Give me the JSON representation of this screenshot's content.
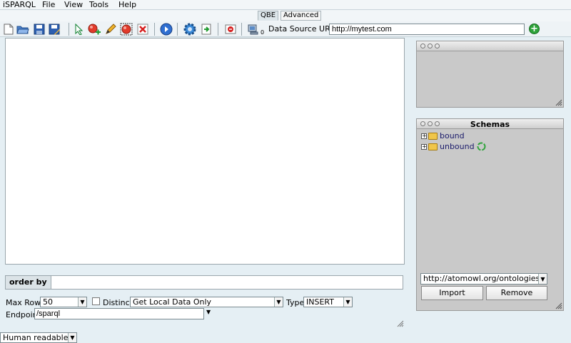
{
  "menubar": {
    "app": "iSPARQL",
    "items": [
      "File",
      "View",
      "Tools",
      "Help"
    ]
  },
  "tabs": [
    {
      "label": "QBE",
      "active": true
    },
    {
      "label": "Advanced",
      "active": false
    }
  ],
  "toolbar": {
    "icons": [
      "new-document-icon",
      "open-folder-icon",
      "save-icon",
      "save-as-icon",
      "pointer-icon",
      "add-node-icon",
      "pencil-icon",
      "group-icon",
      "delete-icon",
      "run-icon",
      "gear-icon",
      "import-icon",
      "export-icon",
      "network-icon"
    ],
    "ds_badge": "0",
    "data_source_label": "Data Source URI",
    "data_source_value": "http://mytest.com"
  },
  "query": {
    "order_by_label": "order by",
    "max_rows_label": "Max Rows",
    "max_rows_value": "50",
    "distinct_label": "Distinct",
    "data_mode_value": "Get Local Data Only",
    "type_label": "Type",
    "type_value": "INSERT",
    "endpoint_label": "Endpoint",
    "endpoint_value": "/sparql",
    "output_format": "Human readable"
  },
  "schemas": {
    "title": "Schemas",
    "items": [
      {
        "label": "bound"
      },
      {
        "label": "unbound"
      }
    ],
    "uri_value": "http://atomowl.org/ontologies/a",
    "import_label": "Import",
    "remove_label": "Remove"
  }
}
